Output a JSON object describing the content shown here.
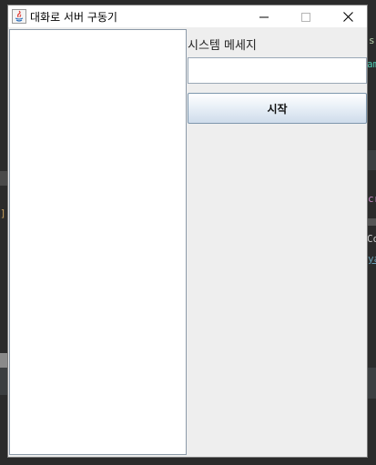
{
  "window": {
    "title": "대화로 서버 구동기",
    "controls": {
      "minimize": "minimize-icon",
      "maximize": "maximize-icon",
      "close": "close-icon"
    }
  },
  "right_panel": {
    "system_message_label": "시스템 메세지",
    "system_message_value": "",
    "start_button_label": "시작"
  },
  "colors": {
    "window_bg": "#eeeeee",
    "titlebar_bg": "#ffffff",
    "button_gradient_top": "#ffffff",
    "button_gradient_bottom": "#cfdceb",
    "desktop_bg": "#2b2b2b"
  }
}
